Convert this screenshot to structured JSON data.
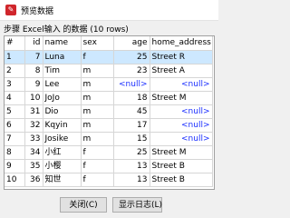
{
  "window": {
    "title": "预览数据",
    "icon": "app-logo-icon",
    "icon_glyph": "✎"
  },
  "subtitle": "步骤 Excel输入 的数据 (10 rows)",
  "table": {
    "columns": [
      "#",
      "id",
      "name",
      "sex",
      "age",
      "home_address"
    ],
    "rows": [
      [
        "1",
        "7",
        "Luna",
        "f",
        "25",
        "Street R"
      ],
      [
        "2",
        "8",
        "Tim",
        "m",
        "23",
        "Street A"
      ],
      [
        "3",
        "9",
        "Lee",
        "m",
        "<null>",
        "<null>"
      ],
      [
        "4",
        "10",
        "JoJo",
        "m",
        "18",
        "Street M"
      ],
      [
        "5",
        "31",
        "Dio",
        "m",
        "45",
        "<null>"
      ],
      [
        "6",
        "32",
        "Kqyin",
        "m",
        "17",
        "<null>"
      ],
      [
        "7",
        "33",
        "Josike",
        "m",
        "15",
        "<null>"
      ],
      [
        "8",
        "34",
        "小红",
        "f",
        "25",
        "Street M"
      ],
      [
        "9",
        "35",
        "小樱",
        "f",
        "13",
        "Street B"
      ],
      [
        "10",
        "36",
        "知世",
        "f",
        "13",
        "Street B"
      ]
    ],
    "selected_row": 0,
    "null_color": "#1a2eff"
  },
  "buttons": {
    "close": "关闭(C)",
    "log": "显示日志(L)"
  }
}
